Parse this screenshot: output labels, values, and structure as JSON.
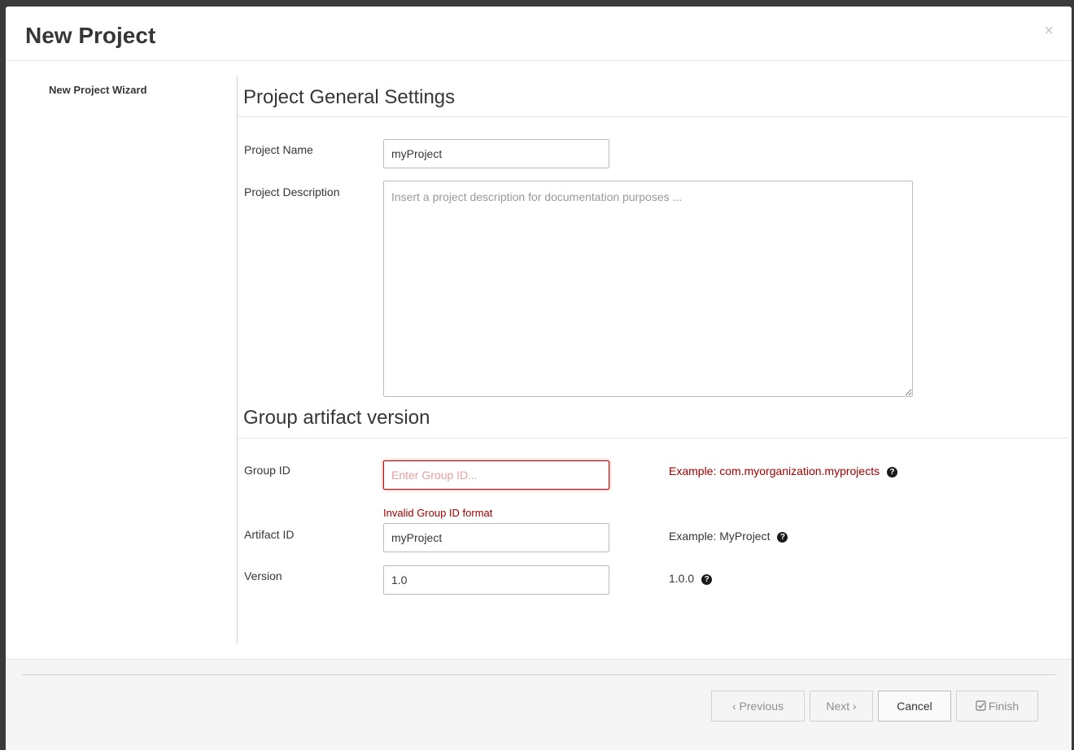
{
  "modal": {
    "title": "New Project",
    "close_glyph": "×"
  },
  "wizard_nav": {
    "items": [
      {
        "label": "New Project Wizard"
      }
    ]
  },
  "general_settings": {
    "title": "Project General Settings",
    "project_name": {
      "label": "Project Name",
      "value": "myProject"
    },
    "project_description": {
      "label": "Project Description",
      "value": "",
      "placeholder": "Insert a project description for documentation purposes ..."
    }
  },
  "gav": {
    "title": "Group artifact version",
    "group_id": {
      "label": "Group ID",
      "value": "",
      "placeholder": "Enter Group ID...",
      "error": "Invalid Group ID format",
      "example": "Example: com.myorganization.myprojects"
    },
    "artifact_id": {
      "label": "Artifact ID",
      "value": "myProject",
      "example": "Example: MyProject"
    },
    "version": {
      "label": "Version",
      "value": "1.0",
      "example": "1.0.0"
    }
  },
  "footer": {
    "previous": "‹ Previous",
    "next": "Next ›",
    "cancel": "Cancel",
    "finish": "Finish",
    "finish_icon": "check-square-icon"
  },
  "colors": {
    "error": "#a30000",
    "header_text": "#363636",
    "footer_bg": "#f5f5f5"
  },
  "icons": {
    "help": "question-circle-icon",
    "close": "close-icon"
  }
}
